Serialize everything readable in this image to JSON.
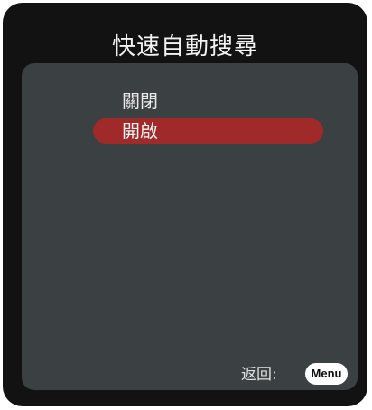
{
  "osd": {
    "title": "快速自動搜尋",
    "options": [
      {
        "label": "關閉",
        "selected": false
      },
      {
        "label": "開啟",
        "selected": true
      }
    ],
    "footer": {
      "back_label": "返回:",
      "menu_button": "Menu"
    }
  },
  "colors": {
    "frame": "#121212",
    "panel": "#3b4043",
    "highlight": "#a02a2a",
    "text": "#e9e9e9"
  }
}
